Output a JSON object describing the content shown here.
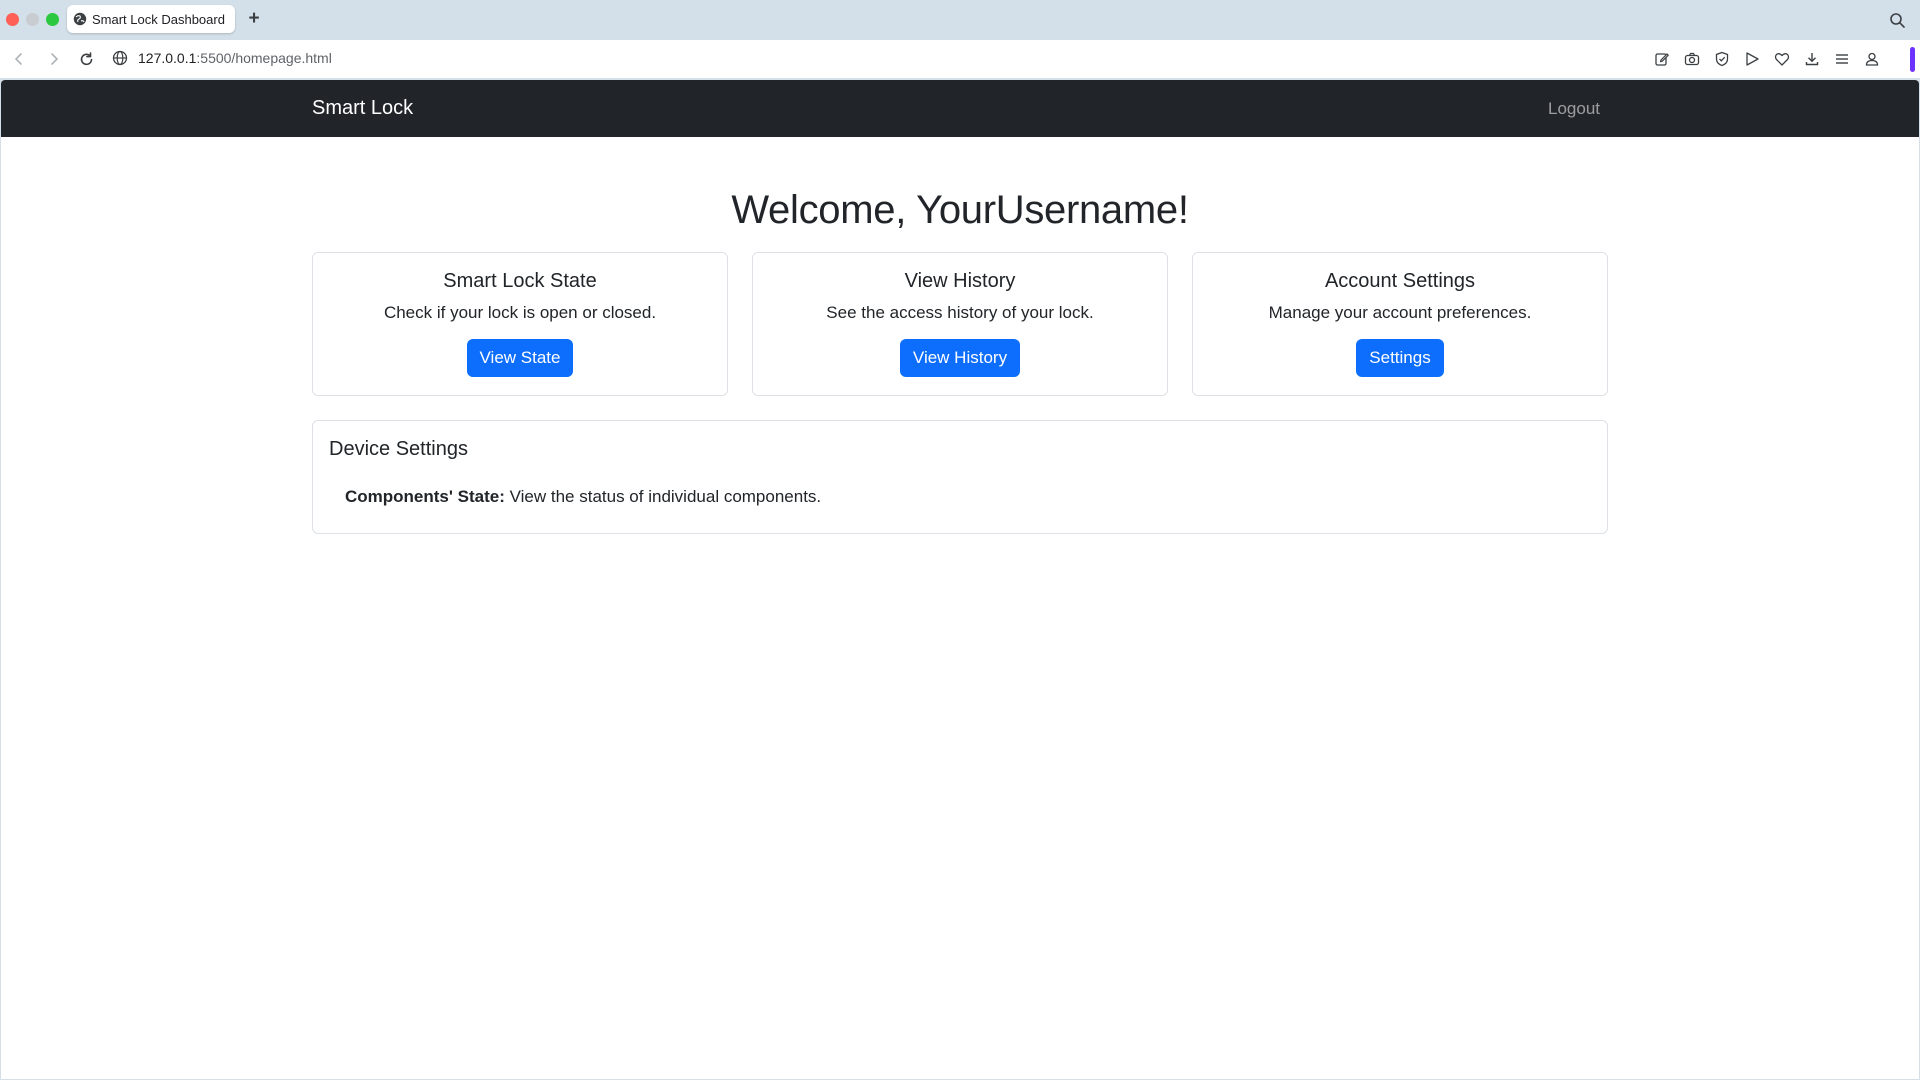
{
  "browser": {
    "tab_title": "Smart Lock Dashboard",
    "new_tab": "+",
    "url_host": "127.0.0.1",
    "url_path": ":5500/homepage.html",
    "toolbar_icons": [
      "edit-icon",
      "camera-icon",
      "shield-icon",
      "send-icon",
      "heart-icon",
      "download-icon",
      "menu-icon",
      "profile-icon"
    ],
    "accent_color": "#6e32ff"
  },
  "navbar": {
    "brand": "Smart Lock",
    "logout": "Logout",
    "background": "#212529"
  },
  "main": {
    "welcome": "Welcome, YourUsername!",
    "cards": [
      {
        "title": "Smart Lock State",
        "text": "Check if your lock is open or closed.",
        "button": "View State"
      },
      {
        "title": "View History",
        "text": "See the access history of your lock.",
        "button": "View History"
      },
      {
        "title": "Account Settings",
        "text": "Manage your account preferences.",
        "button": "Settings"
      }
    ],
    "button_color": "#0d6efd"
  },
  "device_settings": {
    "title": "Device Settings",
    "item_label": "Components' State:",
    "item_text": " View the status of individual components."
  }
}
